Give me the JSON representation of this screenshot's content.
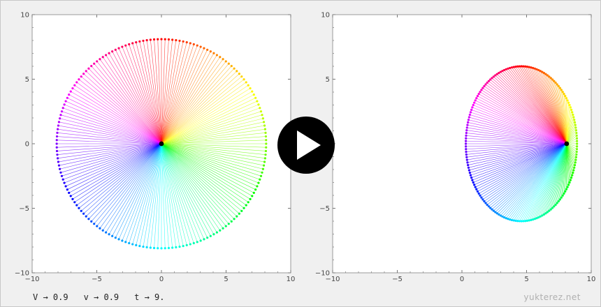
{
  "params": {
    "V": "V → 0.9",
    "v": "v → 0.9",
    "t": "t → 9."
  },
  "watermark": "yukterez.net",
  "play_icon": "play-icon",
  "chart_data": [
    {
      "type": "scatter",
      "title": "",
      "xlabel": "",
      "ylabel": "",
      "xlim": [
        -10,
        10
      ],
      "ylim": [
        -10,
        10
      ],
      "xticks": [
        "−10",
        "−5",
        "0",
        "5",
        "10"
      ],
      "yticks": [
        "−10",
        "−5",
        "0",
        "5",
        "10"
      ],
      "center": [
        0,
        0
      ],
      "ring": {
        "cx": 0,
        "cy": 0,
        "rx": 8.1,
        "ry": 8.1,
        "points": 180
      },
      "grid": false
    },
    {
      "type": "scatter",
      "title": "",
      "xlabel": "",
      "ylabel": "",
      "xlim": [
        -10,
        10
      ],
      "ylim": [
        -10,
        10
      ],
      "xticks": [
        "−10",
        "−5",
        "0",
        "5",
        "10"
      ],
      "yticks": [
        "−10",
        "−5",
        "0",
        "5",
        "10"
      ],
      "center": [
        8.1,
        0
      ],
      "ring": {
        "cx": 4.6,
        "cy": 0,
        "rx": 4.3,
        "ry": 6.0,
        "points": 180
      },
      "grid": false
    }
  ]
}
